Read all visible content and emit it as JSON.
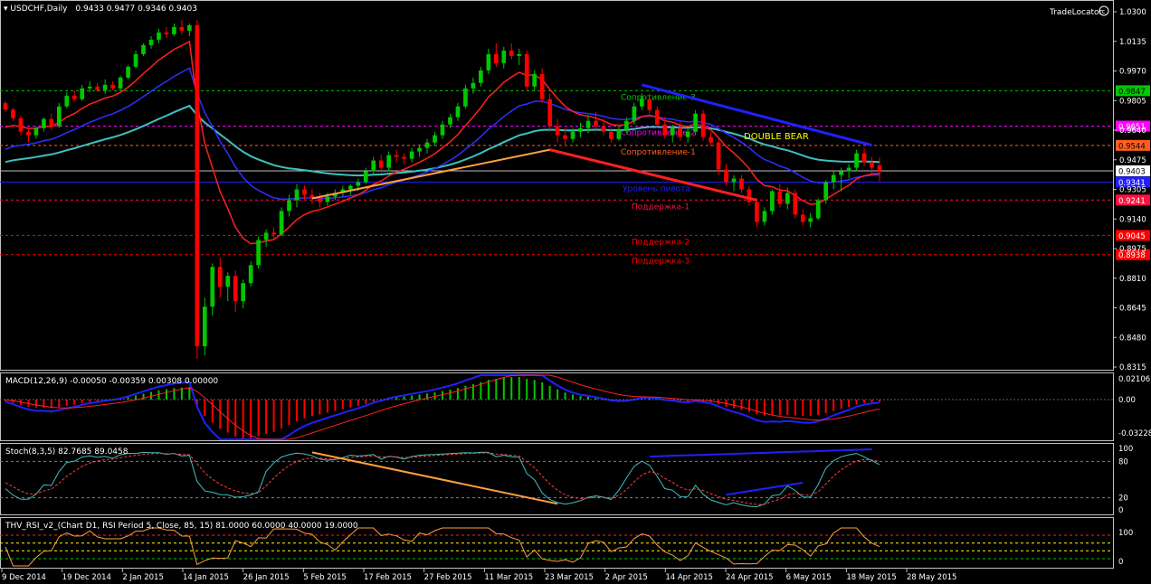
{
  "header": {
    "symbol_title": "USDCHF,Daily",
    "ohlc": "0.9433 0.9477 0.9346 0.9403",
    "brand": "TradeLocator",
    "brand_icon": "copyright-icon"
  },
  "colors": {
    "background": "#000000",
    "bull": "#00c800",
    "bear": "#ff0000",
    "ma_fast": "#ff2020",
    "ma_slow": "#2f2fff",
    "ma_long": "#3fc0c0",
    "trend_blue": "#2020ff",
    "trend_orange": "#ffa040",
    "trend_red": "#ff2020",
    "macd_line": "#2020ff",
    "macd_signal": "#ff2020",
    "stoch_main": "#40c0c0",
    "stoch_signal": "#ff4040",
    "rsi_line": "#ffa040"
  },
  "levels": [
    {
      "label": "Сопротивление-3",
      "price_label": "0.9847",
      "price": 0.9847,
      "color": "#00c800",
      "tag_bg": "#00c800",
      "tag_fg": "#000000"
    },
    {
      "label": "Сопротивление-2",
      "price_label": "0.9651",
      "price": 0.9651,
      "color": "#ff00ff",
      "tag_bg": "#ff00ff",
      "tag_fg": "#ffffff"
    },
    {
      "label": "Сопротивление-1",
      "price_label": "0.9544",
      "price": 0.9544,
      "color": "#ff6020",
      "tag_bg": "#ff6020",
      "tag_fg": "#000000"
    },
    {
      "label": "Уровень пивота",
      "price_label": "0.9341",
      "price": 0.9341,
      "color": "#2020ff",
      "tag_bg": "#2020ff",
      "tag_fg": "#ffffff"
    },
    {
      "label": "Поддержка-1",
      "price_label": "0.9241",
      "price": 0.9241,
      "color": "#ff1040",
      "tag_bg": "#ff1040",
      "tag_fg": "#ffffff"
    },
    {
      "label": "Поддержка-2",
      "price_label": "0.9045",
      "price": 0.9045,
      "color": "#ff0000",
      "tag_bg": "#ff0000",
      "tag_fg": "#ffffff"
    },
    {
      "label": "Поддержка-3",
      "price_label": "0.8938",
      "price": 0.8938,
      "color": "#ff0000",
      "tag_bg": "#ff0000",
      "tag_fg": "#ffffff"
    }
  ],
  "annotation": {
    "text": "DOUBLE BEAR",
    "color": "#ffff00"
  },
  "current_price_label": "0.9403",
  "main_axis_ticks": [
    "1.0300",
    "1.0135",
    "0.9970",
    "0.9805",
    "0.9640",
    "0.9475",
    "0.9305",
    "0.9140",
    "0.8975",
    "0.8810",
    "0.8645",
    "0.8480",
    "0.8315"
  ],
  "macd": {
    "title": "MACD(12,26,9) -0.00050 -0.00359 0.00308 0.00000",
    "ticks": [
      "0.02106",
      "0.00",
      "-0.03228"
    ]
  },
  "stoch": {
    "title": "Stoch(8,3,5) 82.7685 89.0458",
    "ticks": [
      "100",
      "80",
      "20",
      "0"
    ]
  },
  "rsi": {
    "title": "THV_RSI_v2_(Chart D1, RSI Period 5, Close, 85, 15) 81.0000 60.0000 40.0000 19.0000",
    "ticks": [
      "100",
      "0"
    ]
  },
  "date_labels": [
    "9 Dec 2014",
    "19 Dec 2014",
    "2 Jan 2015",
    "14 Jan 2015",
    "26 Jan 2015",
    "5 Feb 2015",
    "17 Feb 2015",
    "27 Feb 2015",
    "11 Mar 2015",
    "23 Mar 2015",
    "2 Apr 2015",
    "14 Apr 2015",
    "24 Apr 2015",
    "6 May 2015",
    "18 May 2015",
    "28 May 2015"
  ],
  "chart_data": {
    "type": "candlestick",
    "symbol": "USDCHF",
    "timeframe": "Daily",
    "ylim": [
      0.8315,
      1.03
    ],
    "candles": [
      [
        0.9778,
        0.979,
        0.973,
        0.9742
      ],
      [
        0.9742,
        0.9752,
        0.968,
        0.9695
      ],
      [
        0.9695,
        0.971,
        0.96,
        0.962
      ],
      [
        0.962,
        0.964,
        0.956,
        0.96
      ],
      [
        0.96,
        0.965,
        0.958,
        0.964
      ],
      [
        0.964,
        0.97,
        0.962,
        0.969
      ],
      [
        0.969,
        0.972,
        0.963,
        0.965
      ],
      [
        0.965,
        0.978,
        0.964,
        0.976
      ],
      [
        0.976,
        0.984,
        0.975,
        0.982
      ],
      [
        0.982,
        0.985,
        0.979,
        0.98
      ],
      [
        0.98,
        0.988,
        0.979,
        0.986
      ],
      [
        0.986,
        0.99,
        0.984,
        0.987
      ],
      [
        0.987,
        0.989,
        0.984,
        0.985
      ],
      [
        0.985,
        0.991,
        0.983,
        0.988
      ],
      [
        0.988,
        0.99,
        0.985,
        0.986
      ],
      [
        0.986,
        0.993,
        0.985,
        0.992
      ],
      [
        0.992,
        0.999,
        0.991,
        0.998
      ],
      [
        0.998,
        1.007,
        0.997,
        1.005
      ],
      [
        1.005,
        1.011,
        1.004,
        1.01
      ],
      [
        1.01,
        1.015,
        1.008,
        1.013
      ],
      [
        1.013,
        1.019,
        1.011,
        1.017
      ],
      [
        1.017,
        1.02,
        1.014,
        1.016
      ],
      [
        1.016,
        1.022,
        1.015,
        1.02
      ],
      [
        1.02,
        1.024,
        1.016,
        1.018
      ],
      [
        1.018,
        1.022,
        1.015,
        1.021
      ],
      [
        1.021,
        1.024,
        0.836,
        0.843
      ],
      [
        0.843,
        0.87,
        0.838,
        0.865
      ],
      [
        0.865,
        0.889,
        0.86,
        0.887
      ],
      [
        0.887,
        0.892,
        0.87,
        0.876
      ],
      [
        0.876,
        0.884,
        0.868,
        0.882
      ],
      [
        0.882,
        0.885,
        0.862,
        0.868
      ],
      [
        0.868,
        0.88,
        0.864,
        0.878
      ],
      [
        0.878,
        0.89,
        0.876,
        0.888
      ],
      [
        0.888,
        0.904,
        0.886,
        0.902
      ],
      [
        0.902,
        0.908,
        0.898,
        0.906
      ],
      [
        0.906,
        0.909,
        0.902,
        0.905
      ],
      [
        0.905,
        0.92,
        0.904,
        0.918
      ],
      [
        0.918,
        0.927,
        0.915,
        0.924
      ],
      [
        0.924,
        0.933,
        0.92,
        0.93
      ],
      [
        0.93,
        0.932,
        0.924,
        0.927
      ],
      [
        0.927,
        0.93,
        0.922,
        0.925
      ],
      [
        0.925,
        0.928,
        0.92,
        0.923
      ],
      [
        0.923,
        0.928,
        0.921,
        0.926
      ],
      [
        0.926,
        0.93,
        0.924,
        0.928
      ],
      [
        0.928,
        0.932,
        0.926,
        0.93
      ],
      [
        0.93,
        0.933,
        0.927,
        0.932
      ],
      [
        0.932,
        0.936,
        0.929,
        0.934
      ],
      [
        0.934,
        0.942,
        0.933,
        0.94
      ],
      [
        0.94,
        0.948,
        0.938,
        0.946
      ],
      [
        0.946,
        0.949,
        0.939,
        0.942
      ],
      [
        0.942,
        0.951,
        0.94,
        0.949
      ],
      [
        0.949,
        0.952,
        0.945,
        0.948
      ],
      [
        0.948,
        0.95,
        0.944,
        0.947
      ],
      [
        0.947,
        0.953,
        0.945,
        0.951
      ],
      [
        0.951,
        0.955,
        0.948,
        0.953
      ],
      [
        0.953,
        0.958,
        0.95,
        0.956
      ],
      [
        0.956,
        0.962,
        0.954,
        0.96
      ],
      [
        0.96,
        0.968,
        0.958,
        0.966
      ],
      [
        0.966,
        0.972,
        0.964,
        0.97
      ],
      [
        0.97,
        0.978,
        0.968,
        0.976
      ],
      [
        0.976,
        0.988,
        0.975,
        0.986
      ],
      [
        0.986,
        0.992,
        0.983,
        0.989
      ],
      [
        0.989,
        0.998,
        0.987,
        0.996
      ],
      [
        0.996,
        1.008,
        0.994,
        1.005
      ],
      [
        1.005,
        1.011,
        0.998,
        1.0
      ],
      [
        1.0,
        1.009,
        0.997,
        1.007
      ],
      [
        1.007,
        1.011,
        1.002,
        1.004
      ],
      [
        1.004,
        1.008,
        0.999,
        1.005
      ],
      [
        1.005,
        1.007,
        0.985,
        0.987
      ],
      [
        0.987,
        0.996,
        0.985,
        0.994
      ],
      [
        0.994,
        0.997,
        0.978,
        0.98
      ],
      [
        0.98,
        0.983,
        0.962,
        0.965
      ],
      [
        0.965,
        0.969,
        0.956,
        0.96
      ],
      [
        0.96,
        0.964,
        0.954,
        0.958
      ],
      [
        0.958,
        0.964,
        0.956,
        0.962
      ],
      [
        0.962,
        0.967,
        0.959,
        0.964
      ],
      [
        0.964,
        0.971,
        0.961,
        0.968
      ],
      [
        0.968,
        0.973,
        0.963,
        0.965
      ],
      [
        0.965,
        0.969,
        0.96,
        0.962
      ],
      [
        0.962,
        0.964,
        0.956,
        0.958
      ],
      [
        0.958,
        0.965,
        0.957,
        0.963
      ],
      [
        0.963,
        0.97,
        0.961,
        0.968
      ],
      [
        0.968,
        0.978,
        0.966,
        0.976
      ],
      [
        0.976,
        0.983,
        0.974,
        0.98
      ],
      [
        0.98,
        0.983,
        0.972,
        0.974
      ],
      [
        0.974,
        0.976,
        0.964,
        0.966
      ],
      [
        0.966,
        0.97,
        0.958,
        0.96
      ],
      [
        0.96,
        0.966,
        0.956,
        0.964
      ],
      [
        0.964,
        0.968,
        0.957,
        0.959
      ],
      [
        0.959,
        0.964,
        0.956,
        0.962
      ],
      [
        0.962,
        0.974,
        0.96,
        0.972
      ],
      [
        0.972,
        0.974,
        0.957,
        0.959
      ],
      [
        0.959,
        0.962,
        0.954,
        0.956
      ],
      [
        0.956,
        0.958,
        0.938,
        0.941
      ],
      [
        0.941,
        0.944,
        0.932,
        0.934
      ],
      [
        0.934,
        0.938,
        0.929,
        0.936
      ],
      [
        0.936,
        0.938,
        0.928,
        0.93
      ],
      [
        0.93,
        0.932,
        0.921,
        0.923
      ],
      [
        0.923,
        0.925,
        0.909,
        0.912
      ],
      [
        0.912,
        0.92,
        0.91,
        0.918
      ],
      [
        0.918,
        0.93,
        0.916,
        0.929
      ],
      [
        0.929,
        0.933,
        0.92,
        0.922
      ],
      [
        0.922,
        0.931,
        0.919,
        0.928
      ],
      [
        0.928,
        0.93,
        0.914,
        0.916
      ],
      [
        0.916,
        0.919,
        0.91,
        0.912
      ],
      [
        0.912,
        0.917,
        0.909,
        0.914
      ],
      [
        0.914,
        0.925,
        0.913,
        0.924
      ],
      [
        0.924,
        0.935,
        0.922,
        0.934
      ],
      [
        0.934,
        0.94,
        0.93,
        0.938
      ],
      [
        0.938,
        0.942,
        0.929,
        0.94
      ],
      [
        0.94,
        0.944,
        0.936,
        0.942
      ],
      [
        0.942,
        0.952,
        0.94,
        0.95
      ],
      [
        0.95,
        0.953,
        0.943,
        0.945
      ],
      [
        0.945,
        0.948,
        0.939,
        0.942
      ],
      [
        0.9433,
        0.9477,
        0.9346,
        0.9403
      ]
    ]
  }
}
